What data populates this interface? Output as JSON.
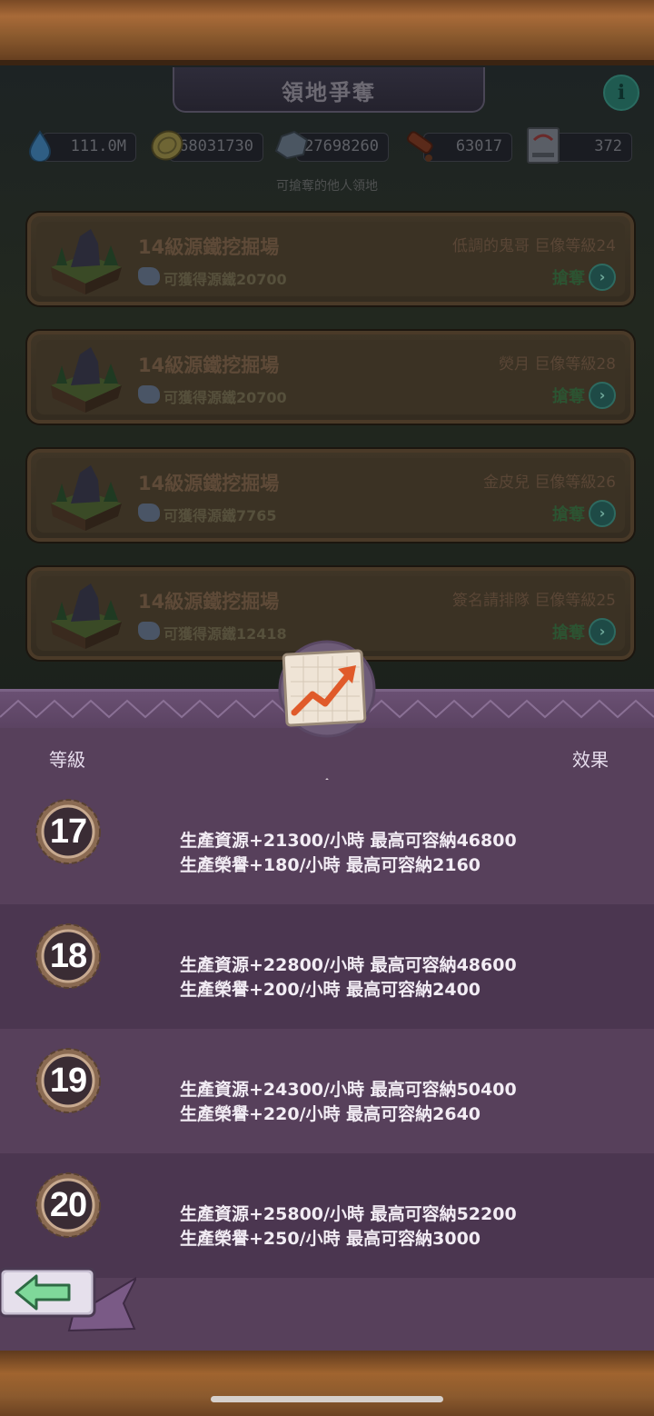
{
  "header": {
    "title": "領地爭奪",
    "subtitle": "可搶奪的他人領地",
    "info_icon": "info-icon"
  },
  "resources": [
    {
      "icon": "water-drop-icon",
      "value": "111.0M"
    },
    {
      "icon": "coin-icon",
      "value": "68031730"
    },
    {
      "icon": "ore-icon",
      "value": "27698260"
    },
    {
      "icon": "scroll-icon",
      "value": "63017"
    },
    {
      "icon": "ticket-icon",
      "value": "372"
    }
  ],
  "territories": [
    {
      "name": "14級源鐵挖掘場",
      "gain": "可獲得源鐵20700",
      "owner": "低調的鬼哥  巨像等級24",
      "action": "搶奪"
    },
    {
      "name": "14級源鐵挖掘場",
      "gain": "可獲得源鐵20700",
      "owner": "熒月  巨像等級28",
      "action": "搶奪"
    },
    {
      "name": "14級源鐵挖掘場",
      "gain": "可獲得源鐵7765",
      "owner": "金皮兒  巨像等級26",
      "action": "搶奪"
    },
    {
      "name": "14級源鐵挖掘場",
      "gain": "可獲得源鐵12418",
      "owner": "簽名請排隊  巨像等級25",
      "action": "搶奪"
    }
  ],
  "upgrade_panel": {
    "header_level": "等級",
    "header_effect": "效果",
    "rows": [
      {
        "level": "17",
        "line1": "生產資源+21300/小時  最高可容納46800",
        "line2": "生產榮譽+180/小時  最高可容納2160"
      },
      {
        "level": "18",
        "line1": "生產資源+22800/小時  最高可容納48600",
        "line2": "生產榮譽+200/小時  最高可容納2400"
      },
      {
        "level": "19",
        "line1": "生產資源+24300/小時  最高可容納50400",
        "line2": "生產榮譽+220/小時  最高可容納2640"
      },
      {
        "level": "20",
        "line1": "生產資源+25800/小時  最高可容納52200",
        "line2": "生產榮譽+250/小時  最高可容納3000"
      }
    ]
  },
  "colors": {
    "panel": "#57405b",
    "panel_alt": "#4b3650",
    "wood": "#8b5a2e"
  }
}
